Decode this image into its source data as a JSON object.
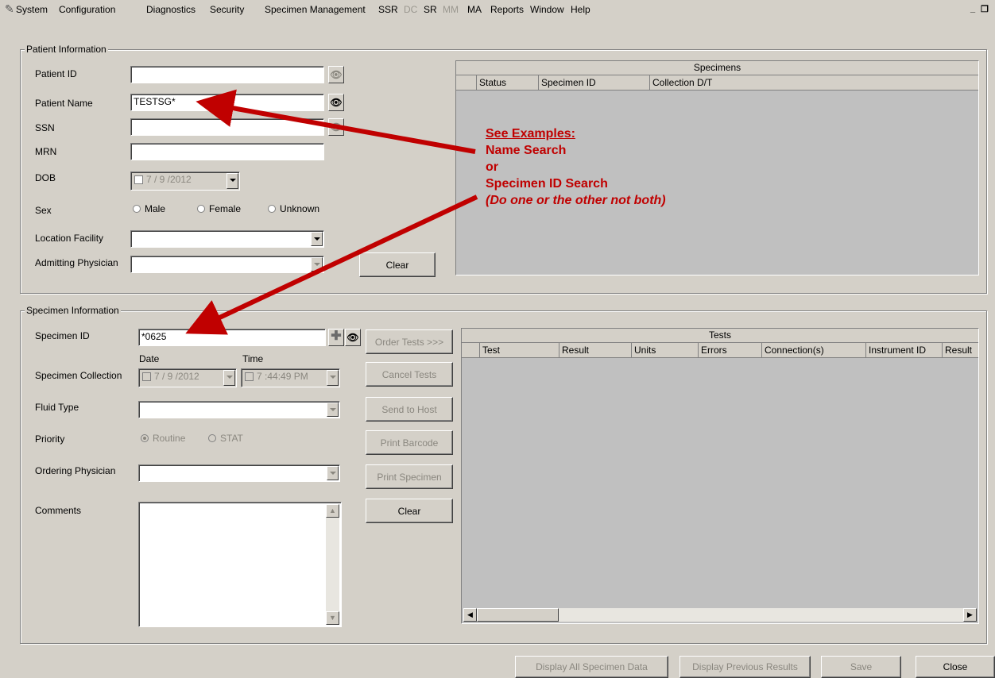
{
  "menu": [
    "System",
    "Configuration",
    "Diagnostics",
    "Security",
    "Specimen Management",
    "SSR",
    "DC",
    "SR",
    "MM",
    "MA",
    "Reports",
    "Window",
    "Help"
  ],
  "window_controls": {
    "minimize": "_",
    "restore": "&#x2750;"
  },
  "patient": {
    "group_title": "Patient Information",
    "patient_id_label": "Patient ID",
    "patient_name_label": "Patient Name",
    "patient_name_value": "TESTSG*",
    "ssn_label": "SSN",
    "mrn_label": "MRN",
    "dob_label": "DOB",
    "dob_value": "7 / 9 /2012",
    "sex_label": "Sex",
    "sex_options": [
      "Male",
      "Female",
      "Unknown"
    ],
    "location_label": "Location Facility",
    "admitting_label": "Admitting Physician",
    "clear_label": "Clear"
  },
  "specimens_grid": {
    "caption": "Specimens",
    "columns": [
      "Status",
      "Specimen ID",
      "Collection D/T"
    ]
  },
  "annotation": {
    "line1": "See Examples:",
    "line2": "Name Search",
    "line3": "or",
    "line4": "Specimen ID Search",
    "line5": "(Do one or the other not both)",
    "color": "#c00000"
  },
  "specimen": {
    "group_title": "Specimen Information",
    "specimen_id_label": "Specimen ID",
    "specimen_id_value": "*0625",
    "date_label": "Date",
    "time_label": "Time",
    "collection_label": "Specimen Collection",
    "collection_date": "7 / 9 /2012",
    "collection_time": "7 :44:49 PM",
    "fluid_label": "Fluid Type",
    "priority_label": "Priority",
    "priority_options": [
      "Routine",
      "STAT"
    ],
    "ordering_label": "Ordering Physician",
    "comments_label": "Comments",
    "buttons": [
      "Order Tests >>>",
      "Cancel Tests",
      "Send to Host",
      "Print Barcode",
      "Print Specimen",
      "Clear"
    ]
  },
  "tests_grid": {
    "caption": "Tests",
    "columns": [
      "Test",
      "Result",
      "Units",
      "Errors",
      "Connection(s)",
      "Instrument ID",
      "Result"
    ]
  },
  "footer": {
    "buttons": [
      "Display All Specimen Data",
      "Display Previous Results",
      "Save",
      "Close"
    ]
  }
}
